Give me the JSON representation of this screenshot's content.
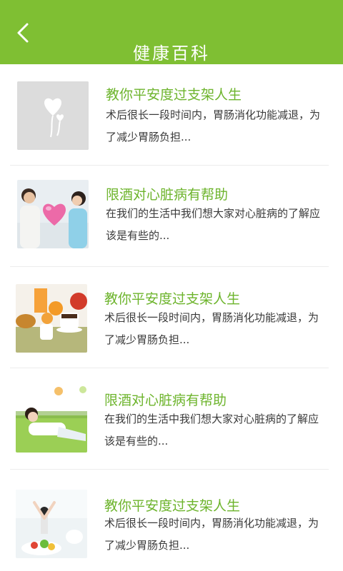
{
  "header": {
    "title": "健康百科",
    "background": "#7fbf33"
  },
  "accent": "#6db42c",
  "articles": [
    {
      "title": "教你平安度过支架人生",
      "desc": "术后很长一段时间内，胃肠消化功能减退，为了减少胃肠负担...",
      "icon": "placeholder-balloon-icon"
    },
    {
      "title": "限酒对心脏病有帮助",
      "desc": "在我们的生活中我们想大家对心脏病的了解应该是有些的...",
      "icon": "couple-heart-photo"
    },
    {
      "title": "教你平安度过支架人生",
      "desc": "术后很长一段时间内，胃肠消化功能减退，为了减少胃肠负担...",
      "icon": "breakfast-photo"
    },
    {
      "title": "限酒对心脏病有帮助",
      "desc": "在我们的生活中我们想大家对心脏病的了解应该是有些的...",
      "icon": "woman-lawn-photo"
    },
    {
      "title": "教你平安度过支架人生",
      "desc": "术后很长一段时间内，胃肠消化功能减退，为了减少胃肠负担...",
      "icon": "yoga-salad-photo"
    }
  ]
}
